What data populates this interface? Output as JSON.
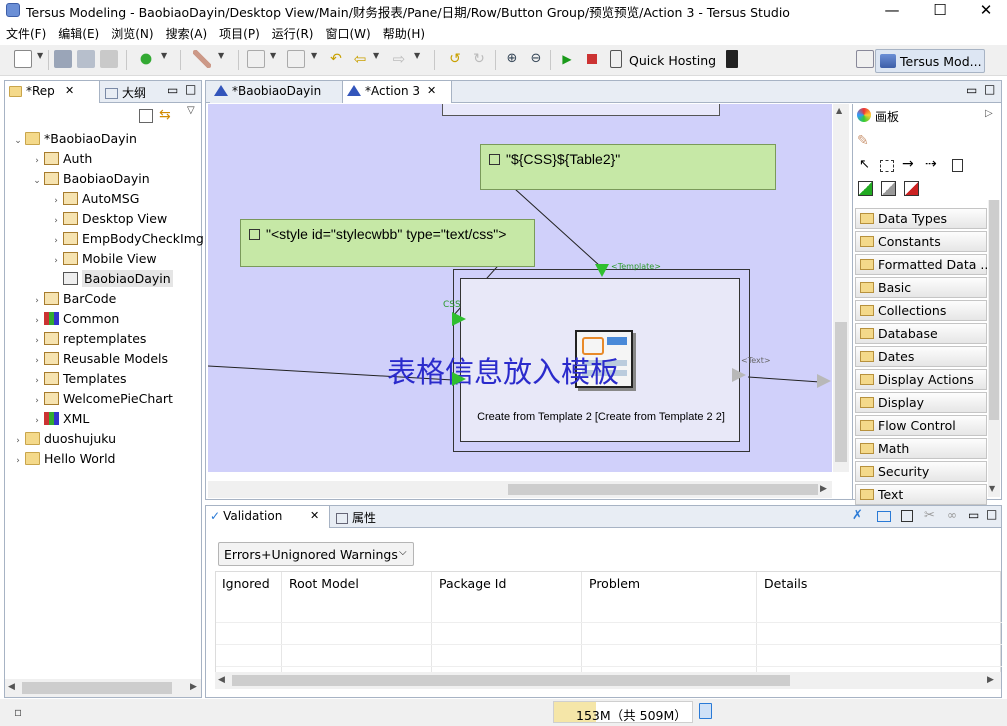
{
  "window": {
    "title": "Tersus Modeling  -  BaobiaoDayin/Desktop View/Main/财务报表/Pane/日期/Row/Button Group/预览预览/Action 3  -  Tersus Studio",
    "minimize": "—",
    "maximize": "☐",
    "close": "✕"
  },
  "menu": [
    "文件(F)",
    "编辑(E)",
    "浏览(N)",
    "搜索(A)",
    "项目(P)",
    "运行(R)",
    "窗口(W)",
    "帮助(H)"
  ],
  "toolbar": {
    "quick_hosting": "Quick Hosting",
    "perspective": "Tersus Mod..."
  },
  "left_panel": {
    "tab_repo": "*Rep",
    "tab_outline": "大纲",
    "tree": [
      {
        "label": "*BaobiaoDayin",
        "icon": "folder-open-icon",
        "level": 0,
        "state": "expanded"
      },
      {
        "label": "Auth",
        "icon": "package-icon",
        "level": 1,
        "state": "collapsed"
      },
      {
        "label": "BaobiaoDayin",
        "icon": "package-icon",
        "level": 1,
        "state": "expanded"
      },
      {
        "label": "AutoMSG",
        "icon": "package-icon",
        "level": 2,
        "state": "collapsed"
      },
      {
        "label": "Desktop View",
        "icon": "package-icon",
        "level": 2,
        "state": "collapsed"
      },
      {
        "label": "EmpBodyCheckImg",
        "icon": "package-icon",
        "level": 2,
        "state": "collapsed"
      },
      {
        "label": "Mobile View",
        "icon": "package-icon",
        "level": 2,
        "state": "collapsed"
      },
      {
        "label": "BaobiaoDayin",
        "icon": "model-icon",
        "level": 2,
        "state": "leaf",
        "selected": true
      },
      {
        "label": "BarCode",
        "icon": "package-icon",
        "level": 1,
        "state": "collapsed"
      },
      {
        "label": "Common",
        "icon": "library-icon",
        "level": 1,
        "state": "collapsed"
      },
      {
        "label": "reptemplates",
        "icon": "package-icon",
        "level": 1,
        "state": "collapsed"
      },
      {
        "label": "Reusable Models",
        "icon": "package-icon",
        "level": 1,
        "state": "collapsed"
      },
      {
        "label": "Templates",
        "icon": "package-icon",
        "level": 1,
        "state": "collapsed"
      },
      {
        "label": "WelcomePieChart",
        "icon": "package-icon",
        "level": 1,
        "state": "collapsed"
      },
      {
        "label": "XML",
        "icon": "library-icon",
        "level": 1,
        "state": "collapsed"
      },
      {
        "label": "duoshujuku",
        "icon": "folder-icon",
        "level": 0,
        "state": "collapsed"
      },
      {
        "label": "Hello World",
        "icon": "folder-icon",
        "level": 0,
        "state": "collapsed"
      }
    ]
  },
  "editor": {
    "tabs": [
      {
        "label": "*BaobiaoDayin",
        "active": false
      },
      {
        "label": "*Action 3",
        "active": true
      }
    ],
    "notes": [
      "\"${CSS}${Table2}\"",
      "\"<style id=\"stylecwbb\" type=\"text/css\">"
    ],
    "element": {
      "caption": "Create from Template 2 [Create from Template 2 2]",
      "overlay_text": "表格信息放入模板",
      "slot_template": "<Template>",
      "slot_css": "CSS",
      "slot_text": "<Text>"
    }
  },
  "palette": {
    "title": "画板",
    "drawers": [
      "Data Types",
      "Constants",
      "Formatted Data ...",
      "Basic",
      "Collections",
      "Database",
      "Dates",
      "Display Actions",
      "Display",
      "Flow Control",
      "Math",
      "Security",
      "Text"
    ]
  },
  "bottom": {
    "tab_validation": "Validation",
    "tab_properties": "属性",
    "filter": "Errors+Unignored Warnings",
    "columns": [
      "Ignored",
      "Root Model",
      "Package Id",
      "Problem",
      "Details"
    ]
  },
  "status": {
    "memory": "153M（共 509M）"
  },
  "colors": {
    "canvas": "#d0d0fa",
    "note": "#c6e8a6",
    "slot_green": "#2fbf2f"
  }
}
